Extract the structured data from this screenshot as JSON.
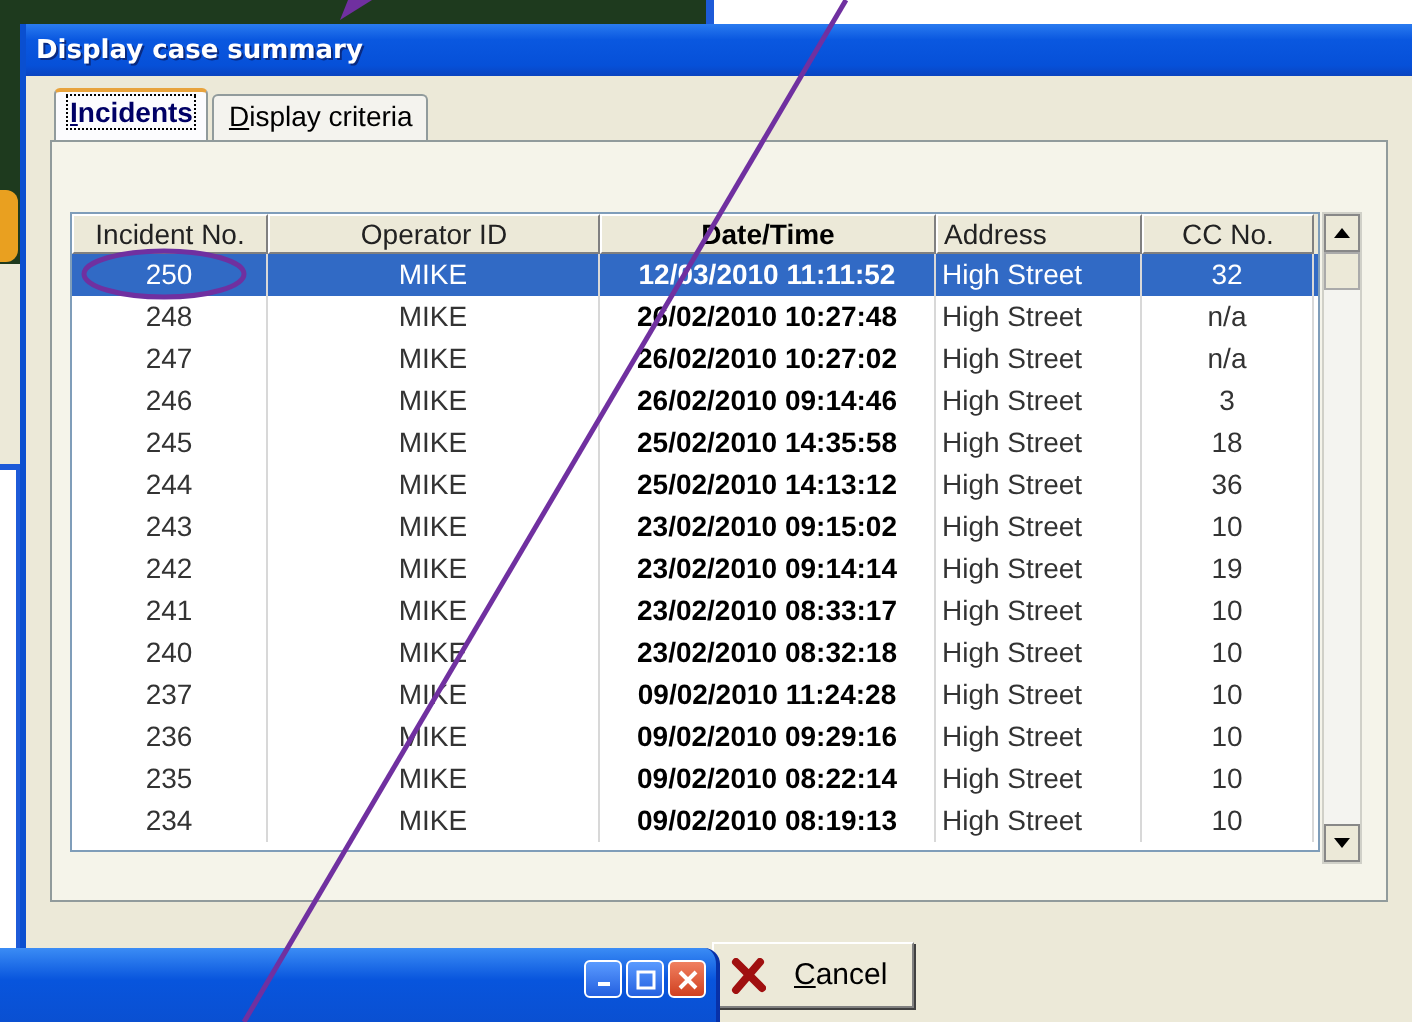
{
  "dialog": {
    "title": "Display case summary",
    "tabs": [
      {
        "label": "Incidents",
        "selected": true
      },
      {
        "label": "Display criteria",
        "selected": false
      }
    ],
    "table": {
      "columns": [
        "Incident No.",
        "Operator ID",
        "Date/Time",
        "Address",
        "CC No."
      ],
      "rows": [
        {
          "cells": [
            "250",
            "MIKE",
            "12/03/2010 11:11:52",
            "High Street",
            "32"
          ],
          "selected": true
        },
        {
          "cells": [
            "248",
            "MIKE",
            "26/02/2010 10:27:48",
            "High Street",
            "n/a"
          ],
          "selected": false
        },
        {
          "cells": [
            "247",
            "MIKE",
            "26/02/2010 10:27:02",
            "High Street",
            "n/a"
          ],
          "selected": false
        },
        {
          "cells": [
            "246",
            "MIKE",
            "26/02/2010 09:14:46",
            "High Street",
            "3"
          ],
          "selected": false
        },
        {
          "cells": [
            "245",
            "MIKE",
            "25/02/2010 14:35:58",
            "High Street",
            "18"
          ],
          "selected": false
        },
        {
          "cells": [
            "244",
            "MIKE",
            "25/02/2010 14:13:12",
            "High Street",
            "36"
          ],
          "selected": false
        },
        {
          "cells": [
            "243",
            "MIKE",
            "23/02/2010 09:15:02",
            "High Street",
            "10"
          ],
          "selected": false
        },
        {
          "cells": [
            "242",
            "MIKE",
            "23/02/2010 09:14:14",
            "High Street",
            "19"
          ],
          "selected": false
        },
        {
          "cells": [
            "241",
            "MIKE",
            "23/02/2010 08:33:17",
            "High Street",
            "10"
          ],
          "selected": false
        },
        {
          "cells": [
            "240",
            "MIKE",
            "23/02/2010 08:32:18",
            "High Street",
            "10"
          ],
          "selected": false
        },
        {
          "cells": [
            "237",
            "MIKE",
            "09/02/2010 11:24:28",
            "High Street",
            "10"
          ],
          "selected": false
        },
        {
          "cells": [
            "236",
            "MIKE",
            "09/02/2010 09:29:16",
            "High Street",
            "10"
          ],
          "selected": false
        },
        {
          "cells": [
            "235",
            "MIKE",
            "09/02/2010 08:22:14",
            "High Street",
            "10"
          ],
          "selected": false
        },
        {
          "cells": [
            "234",
            "MIKE",
            "09/02/2010 08:19:13",
            "High Street",
            "10"
          ],
          "selected": false
        }
      ]
    },
    "buttons": [
      {
        "label": "Cancel",
        "kind": "cancel"
      }
    ]
  }
}
